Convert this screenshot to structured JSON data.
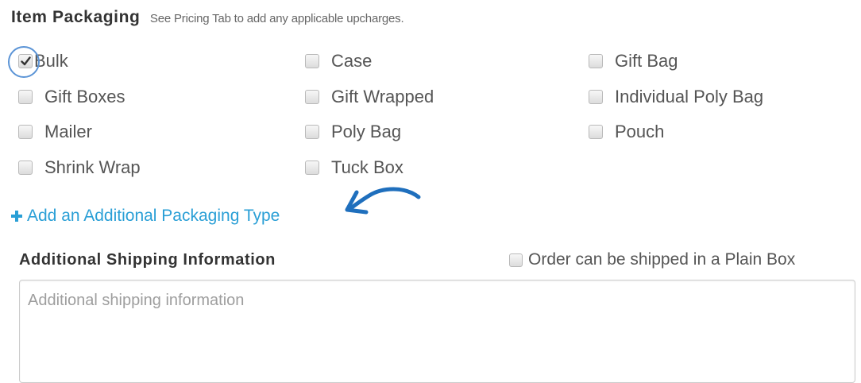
{
  "packaging": {
    "heading": "Item Packaging",
    "hint": "See Pricing Tab to add any applicable upcharges.",
    "options": [
      {
        "label": "Bulk",
        "checked": true
      },
      {
        "label": "Case",
        "checked": false
      },
      {
        "label": "Gift Bag",
        "checked": false
      },
      {
        "label": "Gift Boxes",
        "checked": false
      },
      {
        "label": "Gift Wrapped",
        "checked": false
      },
      {
        "label": "Individual Poly Bag",
        "checked": false
      },
      {
        "label": "Mailer",
        "checked": false
      },
      {
        "label": "Poly Bag",
        "checked": false
      },
      {
        "label": "Pouch",
        "checked": false
      },
      {
        "label": "Shrink Wrap",
        "checked": false
      },
      {
        "label": "Tuck Box",
        "checked": false
      }
    ],
    "add_link": {
      "icon": "plus-icon",
      "label": "Add an Additional Packaging Type"
    }
  },
  "shipping": {
    "heading": "Additional Shipping Information",
    "plain_box": {
      "label": "Order can be shipped in a Plain Box",
      "checked": false
    },
    "textarea": {
      "placeholder": "Additional shipping information",
      "value": ""
    }
  },
  "colors": {
    "link": "#2a9fd6",
    "annotation": "#5b94d6",
    "heading": "#333333",
    "text": "#555555",
    "placeholder": "#9e9e9e"
  }
}
